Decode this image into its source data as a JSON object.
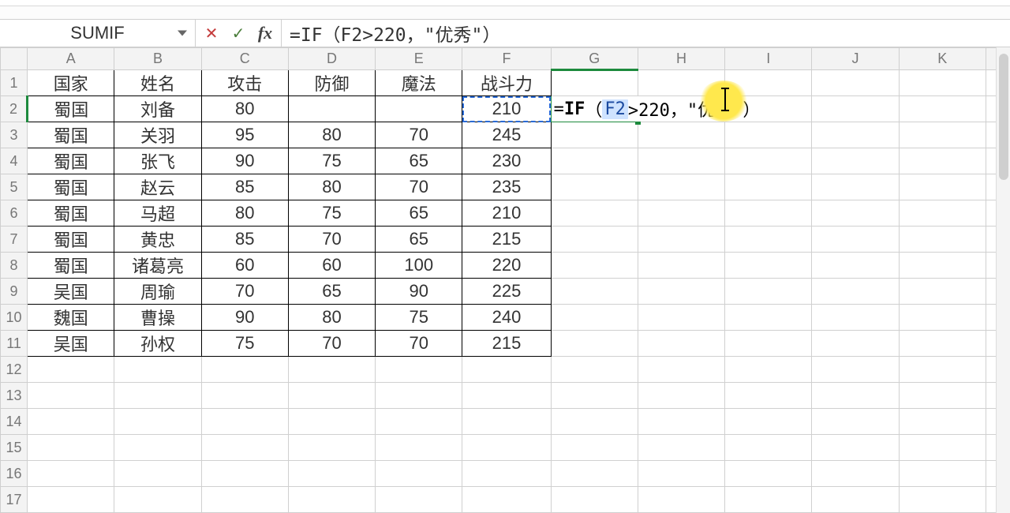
{
  "name_box": "SUMIF",
  "formula_bar": "=IF（F2>220，\"优秀\"）",
  "inline_edit": {
    "pre": "=",
    "fn": "IF",
    "open": "（",
    "ref": "F2",
    "mid": ">220，\"优秀\"",
    "close": "）"
  },
  "columns": [
    "A",
    "B",
    "C",
    "D",
    "E",
    "F",
    "G",
    "H",
    "I",
    "J",
    "K"
  ],
  "row_headers": [
    "1",
    "2",
    "3",
    "4",
    "5",
    "6",
    "7",
    "8",
    "9",
    "10",
    "11",
    "12",
    "13",
    "14",
    "15",
    "16",
    "17"
  ],
  "headers": {
    "A": "国家",
    "B": "姓名",
    "C": "攻击",
    "D": "防御",
    "E": "魔法",
    "F": "战斗力"
  },
  "rows": [
    {
      "A": "蜀国",
      "B": "刘备",
      "C": "80",
      "D": "",
      "E": "",
      "F": "210"
    },
    {
      "A": "蜀国",
      "B": "关羽",
      "C": "95",
      "D": "80",
      "E": "70",
      "F": "245"
    },
    {
      "A": "蜀国",
      "B": "张飞",
      "C": "90",
      "D": "75",
      "E": "65",
      "F": "230"
    },
    {
      "A": "蜀国",
      "B": "赵云",
      "C": "85",
      "D": "80",
      "E": "70",
      "F": "235"
    },
    {
      "A": "蜀国",
      "B": "马超",
      "C": "80",
      "D": "75",
      "E": "65",
      "F": "210"
    },
    {
      "A": "蜀国",
      "B": "黄忠",
      "C": "85",
      "D": "70",
      "E": "65",
      "F": "215"
    },
    {
      "A": "蜀国",
      "B": "诸葛亮",
      "C": "60",
      "D": "60",
      "E": "100",
      "F": "220"
    },
    {
      "A": "吴国",
      "B": "周瑜",
      "C": "70",
      "D": "65",
      "E": "90",
      "F": "225"
    },
    {
      "A": "魏国",
      "B": "曹操",
      "C": "90",
      "D": "80",
      "E": "75",
      "F": "240"
    },
    {
      "A": "吴国",
      "B": "孙权",
      "C": "75",
      "D": "70",
      "E": "70",
      "F": "215"
    }
  ],
  "active": {
    "col": "G",
    "row": 2
  },
  "ref_cell": {
    "col": "F",
    "row": 2
  }
}
